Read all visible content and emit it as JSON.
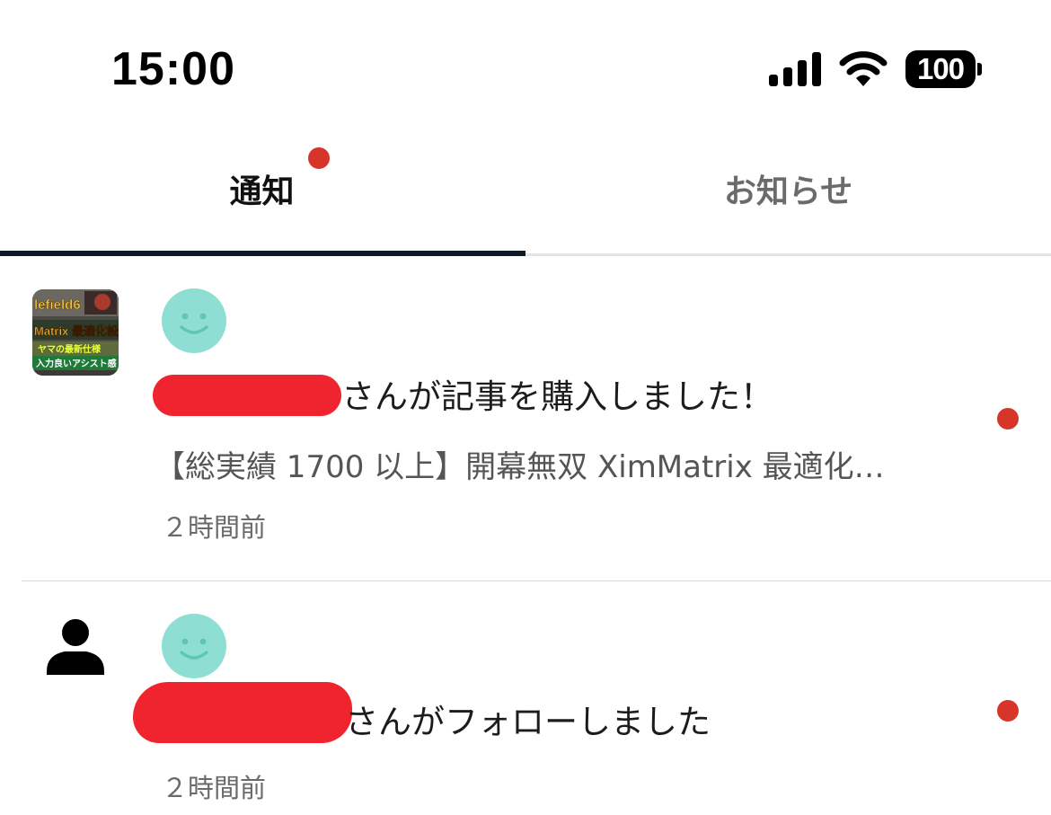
{
  "status_bar": {
    "time": "15:00",
    "battery": "100",
    "icons": [
      "cellular-signal-icon",
      "wifi-icon",
      "battery-icon"
    ]
  },
  "tabs": [
    {
      "label": "通知",
      "active": true,
      "has_badge": true
    },
    {
      "label": "お知らせ",
      "active": false,
      "has_badge": false
    }
  ],
  "notifications": [
    {
      "message": "さんが記事を購入しました！",
      "article_title": "【総実績 1700 以上】開幕無双 XimMatrix 最適化…",
      "timestamp": "２時間前",
      "unread": true,
      "thumbnail": {
        "lines": [
          "lefield6",
          "Matrix 最適化設定",
          "ヤマの最新仕様",
          "入力良いアシスト感"
        ]
      }
    },
    {
      "message": "さんがフォローしました",
      "timestamp": "２時間前",
      "unread": true
    }
  ],
  "colors": {
    "accent_dot": "#d7352a",
    "avatar_bg": "#8fded3",
    "redaction": "#f0242e",
    "active_tab_underline": "#0e1a26"
  }
}
